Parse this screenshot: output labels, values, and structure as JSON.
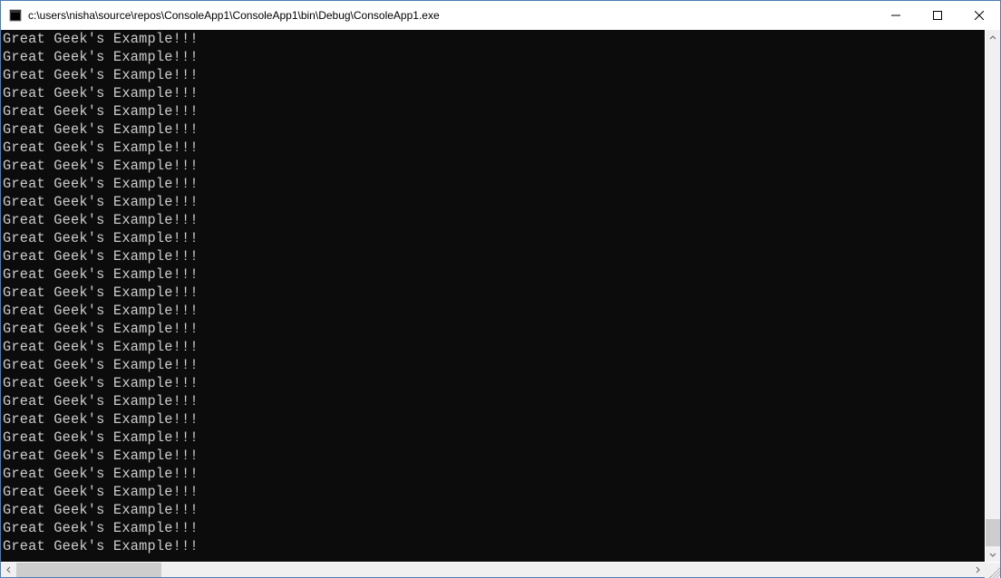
{
  "titlebar": {
    "title": "c:\\users\\nisha\\source\\repos\\ConsoleApp1\\ConsoleApp1\\bin\\Debug\\ConsoleApp1.exe"
  },
  "console": {
    "output_line": "Great Geek's Example!!!",
    "visible_line_count": 29
  }
}
